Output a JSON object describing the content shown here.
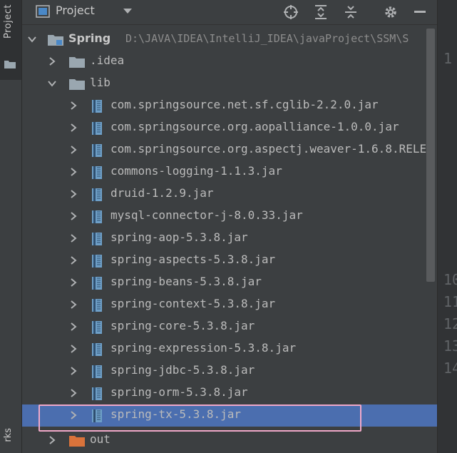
{
  "stripe": {
    "project_label": "Project",
    "bottom_label": "rks"
  },
  "header": {
    "title": "Project"
  },
  "tree": {
    "root": {
      "name": "Spring",
      "path": "D:\\JAVA\\IDEA\\IntelliJ_IDEA\\javaProject\\SSM\\S"
    },
    "idea": ".idea",
    "lib": "lib",
    "jars": [
      "com.springsource.net.sf.cglib-2.2.0.jar",
      "com.springsource.org.aopalliance-1.0.0.jar",
      "com.springsource.org.aspectj.weaver-1.6.8.RELE",
      "commons-logging-1.1.3.jar",
      "druid-1.2.9.jar",
      "mysql-connector-j-8.0.33.jar",
      "spring-aop-5.3.8.jar",
      "spring-aspects-5.3.8.jar",
      "spring-beans-5.3.8.jar",
      "spring-context-5.3.8.jar",
      "spring-core-5.3.8.jar",
      "spring-expression-5.3.8.jar",
      "spring-jdbc-5.3.8.jar",
      "spring-orm-5.3.8.jar",
      "spring-tx-5.3.8.jar"
    ],
    "selected_jar": "spring-tx-5.3.8.jar",
    "out": "out"
  },
  "gutter": {
    "line_numbers": [
      "1",
      "",
      "",
      "",
      "",
      "",
      "",
      "",
      "",
      "",
      "10",
      "11",
      "12",
      "13",
      "14"
    ]
  },
  "colors": {
    "selection": "#4b6eaf",
    "highlight_box": "#f0a8c8",
    "background": "#3c3f41"
  }
}
